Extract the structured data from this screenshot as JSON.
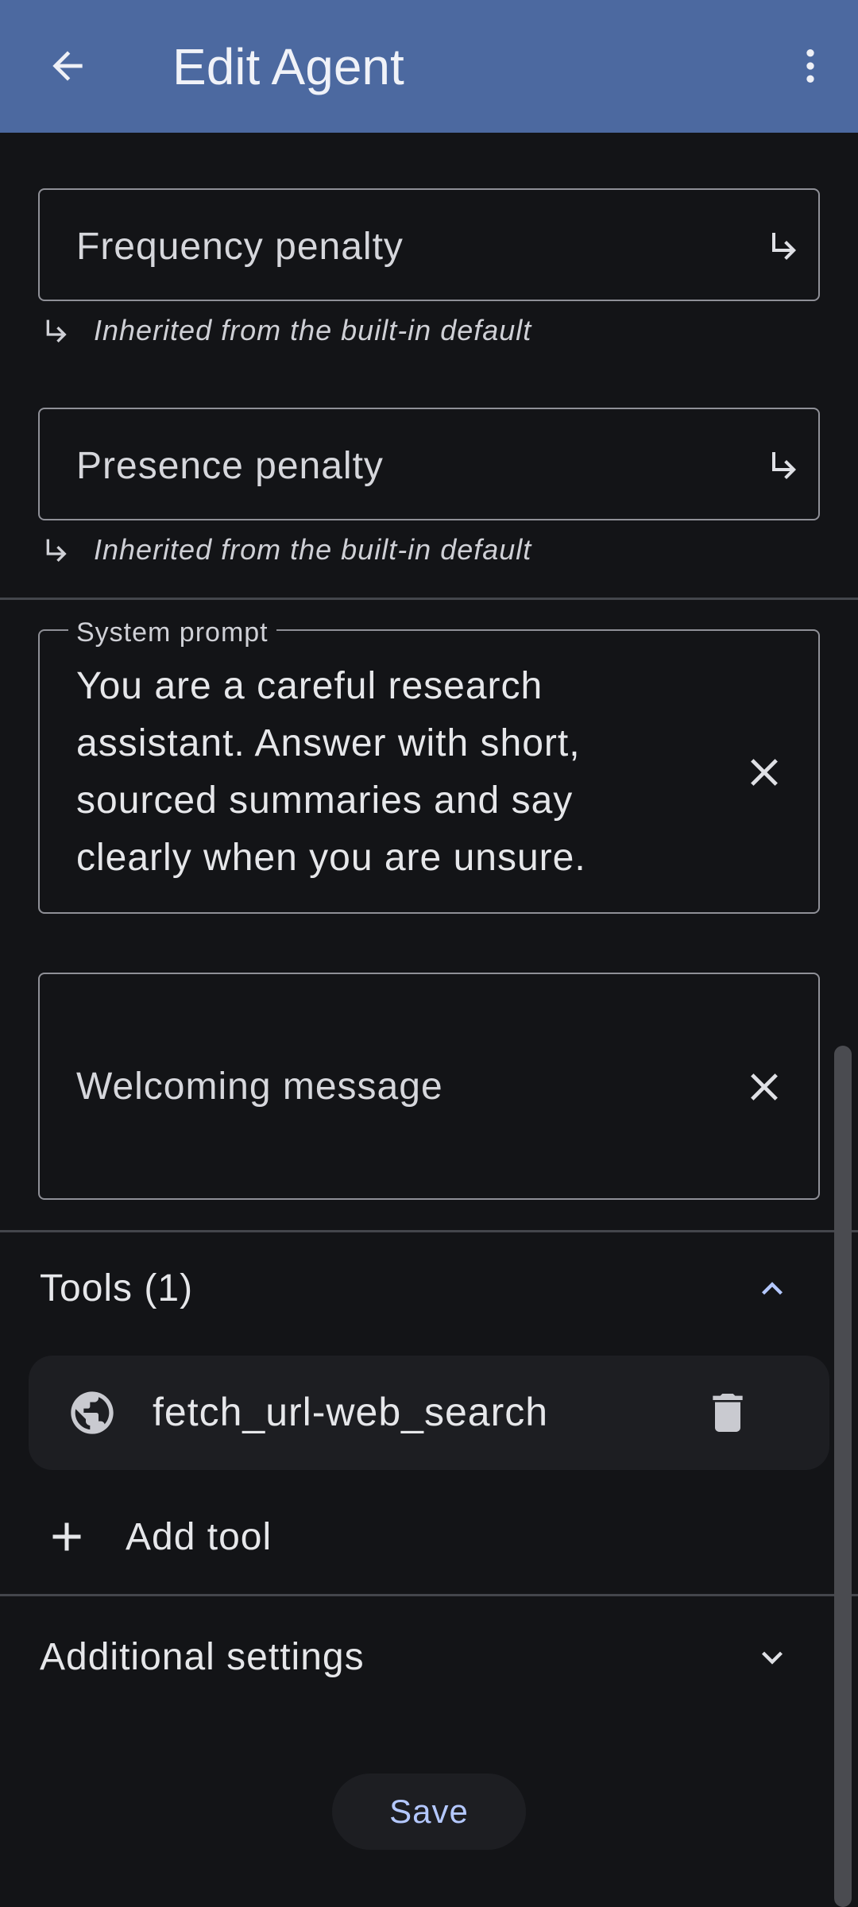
{
  "app_bar": {
    "title": "Edit Agent",
    "back_icon": "arrow-left-icon",
    "more_icon": "more-vert-icon"
  },
  "frequency_penalty": {
    "label": "Frequency penalty",
    "hint": "Inherited from the built-in default",
    "icon": "subdirectory-arrow-right-icon"
  },
  "presence_penalty": {
    "label": "Presence penalty",
    "hint": "Inherited from the built-in default",
    "icon": "subdirectory-arrow-right-icon"
  },
  "system_prompt": {
    "label": "System prompt",
    "value": "You are a careful research assistant. Answer with short, sourced summaries and say clearly when you are unsure.",
    "clear_icon": "close-icon"
  },
  "welcoming_message": {
    "placeholder": "Welcoming message",
    "clear_icon": "close-icon"
  },
  "tools": {
    "title": "Tools (1)",
    "expanded": true,
    "items": [
      {
        "name": "fetch_url-web_search",
        "icon": "globe-icon",
        "delete_icon": "trash-icon"
      }
    ],
    "add_label": "Add tool"
  },
  "additional_settings": {
    "title": "Additional settings",
    "expanded": false
  },
  "save_label": "Save",
  "colors": {
    "app_bar": "#4c69a0",
    "background": "#131417",
    "accent": "#b4c8ff"
  }
}
